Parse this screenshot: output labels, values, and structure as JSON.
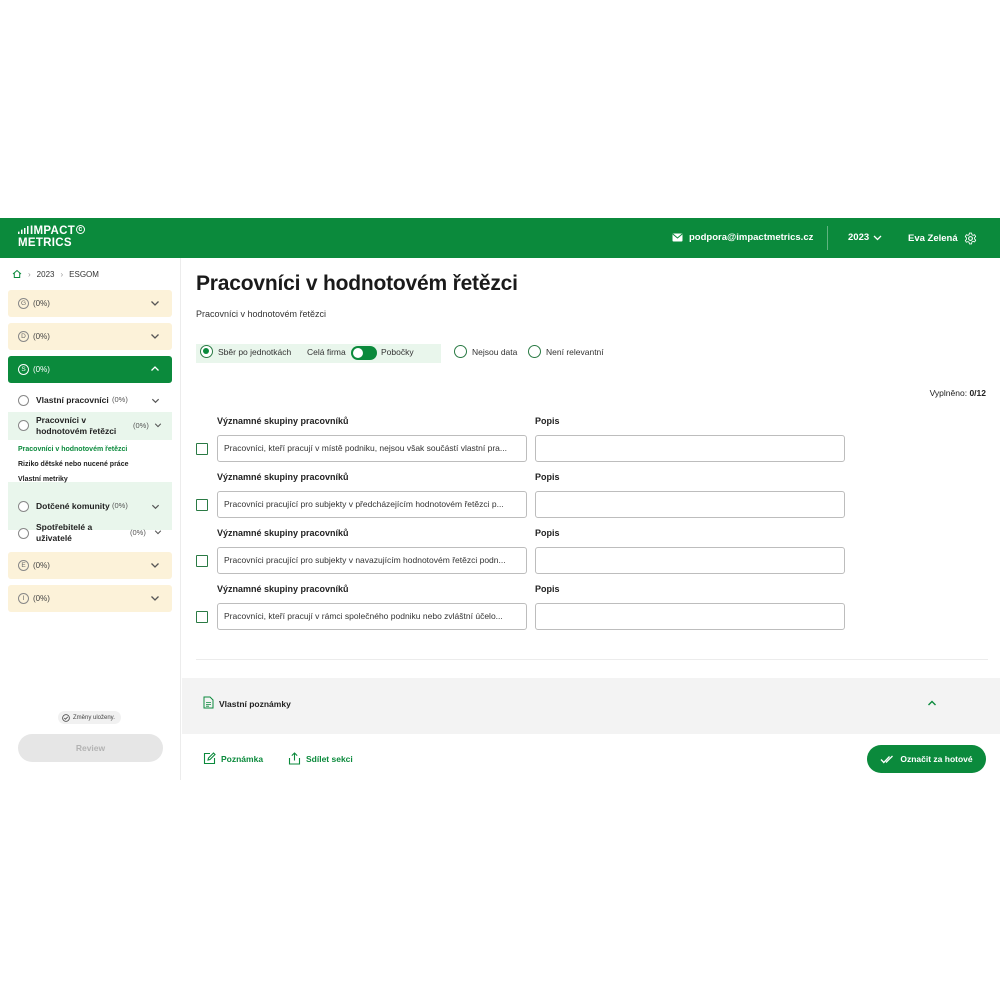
{
  "header": {
    "logo_line1": "IMPACT",
    "logo_line2": "METRICS",
    "email": "podpora@impactmetrics.cz",
    "year": "2023",
    "user": "Eva Zelená",
    "brand_color": "#0b8a3c"
  },
  "breadcrumb": [
    "2023",
    "ESGOM"
  ],
  "sidebar": {
    "sections": [
      {
        "letter": "G",
        "pct": "(0%)"
      },
      {
        "letter": "D",
        "pct": "(0%)"
      },
      {
        "letter": "S",
        "pct": "(0%)"
      },
      {
        "letter": "E",
        "pct": "(0%)"
      },
      {
        "letter": "I",
        "pct": "(0%)"
      }
    ],
    "subitems": [
      {
        "label": "Vlastní pracovníci",
        "pct": "(0%)"
      },
      {
        "label_1": "Pracovníci v",
        "label_2": "hodnotovém řetězci",
        "pct": "(0%)"
      },
      {
        "label": "Dotčené komunity",
        "pct": "(0%)"
      },
      {
        "label_1": "Spotřebitelé a",
        "label_2": "uživatelé",
        "pct": "(0%)"
      }
    ],
    "leaves": [
      "Pracovníci v hodnotovém řetězci",
      "Riziko dětské nebo nucené práce",
      "Vlastní metriky"
    ],
    "saved_status": "Změny uloženy.",
    "review_button": "Review"
  },
  "main": {
    "title": "Pracovníci v hodnotovém řetězci",
    "subtitle": "Pracovníci v hodnotovém řetězci",
    "options": {
      "by_units": "Sběr po jednotkách",
      "whole_company": "Celá firma",
      "branches": "Pobočky",
      "no_data": "Nejsou data",
      "not_relevant": "Není relevantní"
    },
    "filled_label": "Vyplněno:",
    "filled_value": "0/12",
    "rows": [
      {
        "label": "Významné skupiny pracovníků",
        "desc_label": "Popis",
        "value": "Pracovníci, kteří pracují v místě podniku, nejsou však součástí vlastní pra..."
      },
      {
        "label": "Významné skupiny pracovníků",
        "desc_label": "Popis",
        "value": "Pracovníci pracující pro subjekty v předcházejícím hodnotovém řetězci p..."
      },
      {
        "label": "Významné skupiny pracovníků",
        "desc_label": "Popis",
        "value": "Pracovníci pracující pro subjekty v navazujícím hodnotovém řetězci podn..."
      },
      {
        "label": "Významné skupiny pracovníků",
        "desc_label": "Popis",
        "value": "Pracovníci, kteří pracují v rámci společného podniku nebo zvláštní účelo..."
      }
    ],
    "notes_label": "Vlastní poznámky",
    "footer": {
      "note": "Poznámka",
      "share": "Sdílet sekci",
      "mark_done": "Označit za hotové"
    }
  }
}
